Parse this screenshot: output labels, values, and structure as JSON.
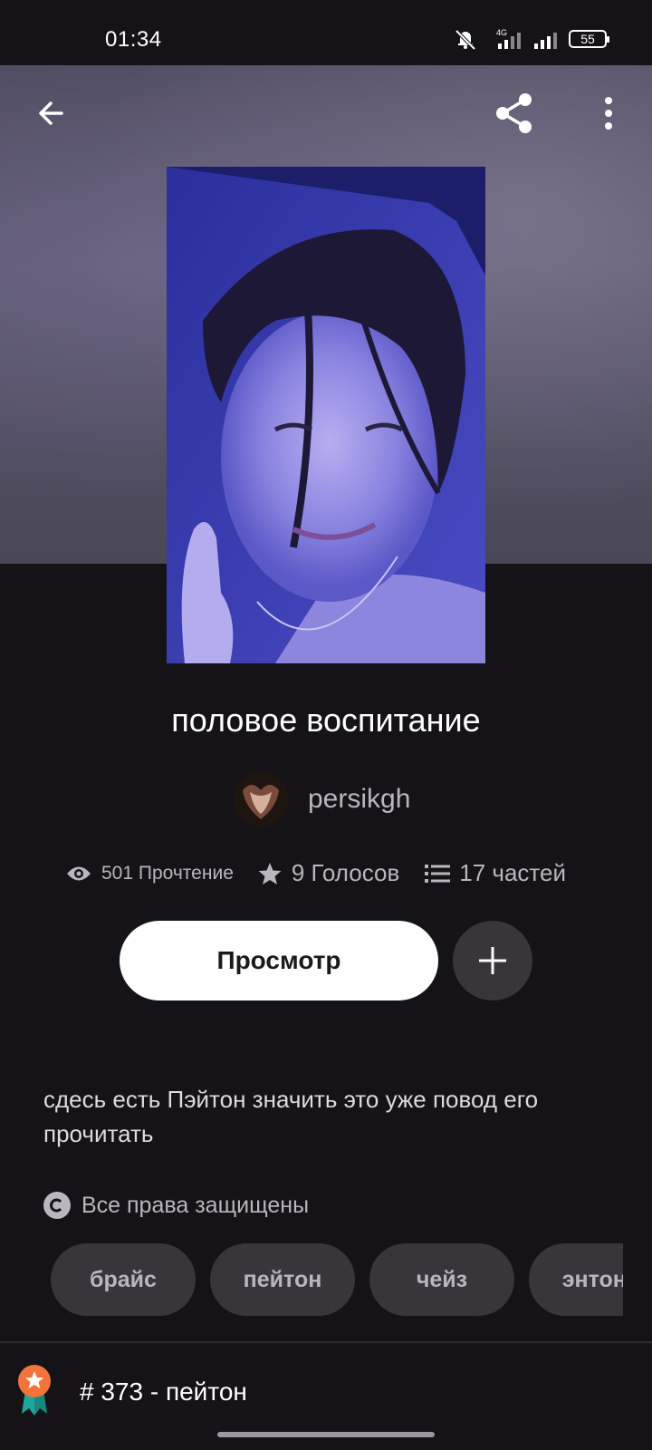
{
  "status_bar": {
    "time": "01:34",
    "network": "4G",
    "battery": "55"
  },
  "toolbar": {
    "back_icon": "arrow-left-icon",
    "share_icon": "share-icon",
    "more_icon": "more-vertical-icon"
  },
  "story": {
    "title": "половое воспитание",
    "author": "persikgh",
    "stats": {
      "reads": "501 Прочтение",
      "votes": "9 Голосов",
      "parts": "17 частей"
    },
    "read_button": "Просмотр",
    "description": "сдесь есть Пэйтон значить это уже повод его прочитать",
    "copyright": "Все права защищены",
    "tags": [
      "брайс",
      "пейтон",
      "чейз",
      "энтони"
    ],
    "ranking": "# 373 - пейтон"
  },
  "colors": {
    "background": "#151317",
    "accent_badge": "#f2743a",
    "badge_ribbon": "#1fa59a"
  }
}
